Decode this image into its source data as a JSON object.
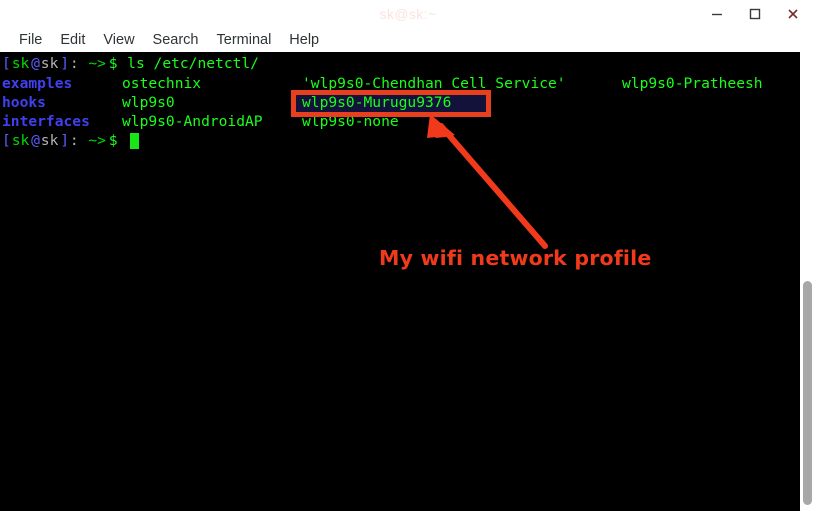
{
  "window": {
    "title": "sk@sk:~",
    "controls": {
      "minimize": "minimize",
      "maximize": "maximize",
      "close": "close"
    }
  },
  "menubar": {
    "items": [
      {
        "label": "File"
      },
      {
        "label": "Edit"
      },
      {
        "label": "View"
      },
      {
        "label": "Search"
      },
      {
        "label": "Terminal"
      },
      {
        "label": "Help"
      }
    ]
  },
  "terminal": {
    "prompt": {
      "open_bracket": "[",
      "user": "sk",
      "at": "@",
      "host": "sk",
      "close_bracket": "]",
      "colon": ":",
      "path": " ~>",
      "dollar": "$"
    },
    "command": " ls /etc/netctl/",
    "listing": {
      "col1": [
        "examples",
        "hooks",
        "interfaces"
      ],
      "col2": [
        "ostechnix",
        "wlp9s0",
        "wlp9s0-AndroidAP"
      ],
      "col3": [
        "'wlp9s0-Chendhan Cell Service'",
        "wlp9s0-Murugu9376",
        "wlp9s0-none"
      ],
      "col4": [
        "wlp9s0-Pratheesh"
      ]
    },
    "highlighted_entry": "wlp9s0-Murugu9376",
    "cursor": "block-cursor"
  },
  "annotation": {
    "label": "My wifi network profile",
    "box_target": "wlp9s0-Murugu9376",
    "color": "#f03a1b"
  },
  "scrollbar": {
    "orientation": "vertical",
    "thumb": "scroll-thumb"
  },
  "colors": {
    "terminal_bg": "#000000",
    "dir_blue": "#4040ef",
    "file_green": "#00d900",
    "selection_bg": "#12123a",
    "annotation_red": "#e8401f",
    "cursor_green": "#19e619",
    "scrollbar_thumb": "#a8a8a8"
  }
}
